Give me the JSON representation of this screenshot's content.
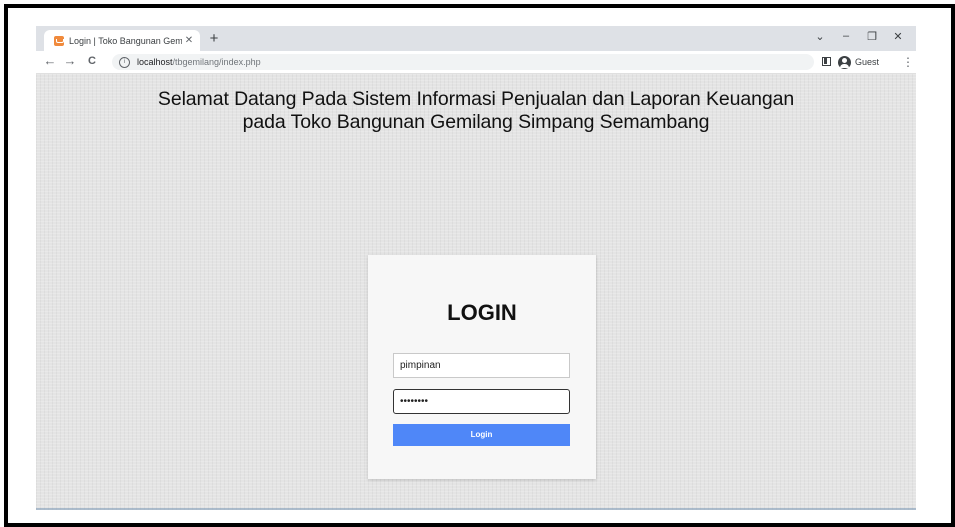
{
  "browser": {
    "tab": {
      "title": "Login | Toko Bangunan Gemilang",
      "close": "✕"
    },
    "new_tab": "+",
    "window_controls": {
      "dropdown": "⌄",
      "minimize": "–",
      "restore": "❐",
      "close": "✕"
    },
    "nav": {
      "back": "←",
      "forward": "→",
      "reload": "C"
    },
    "url": {
      "host": "localhost",
      "path": "/tbgemilang/index.php"
    },
    "profile_label": "Guest",
    "menu": "⋮"
  },
  "page": {
    "headline_line1": "Selamat Datang Pada Sistem Informasi Penjualan dan Laporan Keuangan",
    "headline_line2": "pada Toko Bangunan Gemilang Simpang Semambang",
    "login": {
      "title": "LOGIN",
      "username_value": "pimpinan",
      "password_value": "••••••••",
      "submit_label": "Login"
    }
  },
  "colors": {
    "accent": "#4f87f8",
    "page_bg": "#e4e4e4",
    "favicon": "#f08a3c"
  }
}
